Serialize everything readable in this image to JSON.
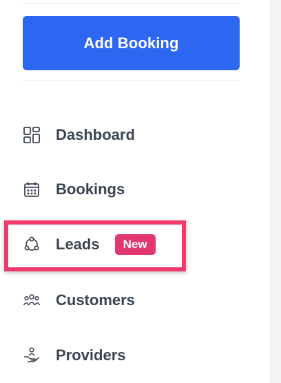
{
  "sidebar": {
    "add_booking_label": "Add Booking",
    "items": [
      {
        "id": "dashboard",
        "label": "Dashboard",
        "icon": "dashboard-icon"
      },
      {
        "id": "bookings",
        "label": "Bookings",
        "icon": "calendar-icon"
      },
      {
        "id": "leads",
        "label": "Leads",
        "icon": "leads-icon",
        "badge": "New"
      },
      {
        "id": "customers",
        "label": "Customers",
        "icon": "customers-icon"
      },
      {
        "id": "providers",
        "label": "Providers",
        "icon": "providers-icon"
      }
    ]
  },
  "colors": {
    "primary": "#2d66f0",
    "badge": "#e0386f",
    "highlight": "#f23a6c",
    "text": "#3a4552"
  }
}
